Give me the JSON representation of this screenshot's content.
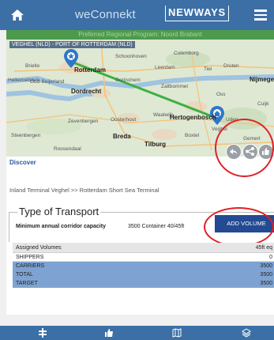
{
  "header": {
    "app_name": "weConnekt",
    "brand_mark": "NEWWAYS",
    "icons": {
      "home": "home-icon",
      "menu": "menu-icon"
    }
  },
  "program_bar": {
    "text": "Preferred Regional Program: Noord Brabant"
  },
  "map": {
    "route_label": "VEGHEL (NLD) - PORT OF ROTTERDAM (NLD)",
    "places": [
      "Brielle",
      "Rotterdam",
      "Schoonhoven",
      "Culemborg",
      "Leerdam",
      "Tiel",
      "Druten",
      "Nijmegen",
      "Hellevoetsluis",
      "Oud-Beijerland",
      "Dordrecht",
      "Gorinchem",
      "Zaltbommel",
      "Oss",
      "Cuijk",
      "Zevenbergen",
      "Oosterhout",
      "Waalwijk",
      "Hertogenbosch",
      "Uden",
      "Breda",
      "Boxtel",
      "Veghel",
      "Steenbergen",
      "Roosendaal",
      "Tilburg",
      "Gemert"
    ],
    "action_icons": [
      "share-icon",
      "share-alt-icon",
      "thumbs-up-icon"
    ]
  },
  "discover": {
    "label": "Discover"
  },
  "route_description": "Inland Terminal Veghel >> Rotterdam Short Sea Terminal",
  "transport": {
    "legend": "Type of Transport",
    "capacity_label": "Minimum annual corridor capacity",
    "capacity_value": "3500 Container 40/45ft",
    "add_volume_label": "ADD VOLUME"
  },
  "volumes": {
    "header_label": "Assigned Volumes",
    "header_value": "45ft eq",
    "rows": [
      {
        "label": "SHIPPERS",
        "value": "0"
      },
      {
        "label": "CARRIERS",
        "value": "3500"
      },
      {
        "label": "TOTAL",
        "value": "3500"
      },
      {
        "label": "TARGET",
        "value": "3500"
      }
    ]
  },
  "bottom_nav": {
    "icons": [
      "route-icon",
      "thumbs-up-icon",
      "map-icon",
      "layers-icon"
    ]
  },
  "colors": {
    "header": "#3b6fa6",
    "program_bar": "#4d9a4d",
    "primary_button": "#234a92",
    "highlight_circle": "#e01f26",
    "table_row_blue": "#7ea3d2"
  }
}
